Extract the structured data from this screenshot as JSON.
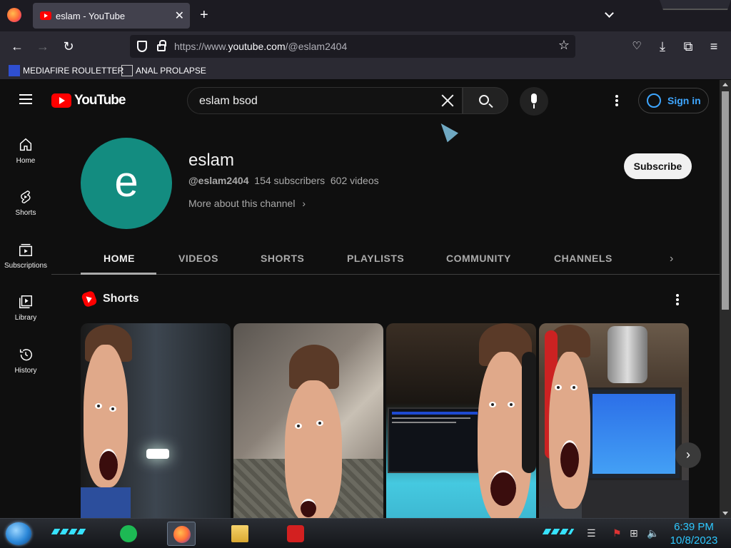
{
  "browser": {
    "tab_title": "eslam - YouTube",
    "new_tab_label": "+",
    "url_prefix": "https://www.",
    "url_domain": "youtube.com",
    "url_path": "/@eslam2404",
    "bookmarks": [
      "MEDIAFIRE ROULETTER",
      "ANAL PROLAPSE"
    ]
  },
  "youtube": {
    "logo_text": "YouTube",
    "search_value": "eslam bsod",
    "sign_in_label": "Sign in",
    "sidebar": [
      {
        "label": "Home",
        "icon": "home-icon"
      },
      {
        "label": "Shorts",
        "icon": "shorts-icon"
      },
      {
        "label": "Subscriptions",
        "icon": "subscriptions-icon"
      },
      {
        "label": "Library",
        "icon": "library-icon"
      },
      {
        "label": "History",
        "icon": "history-icon"
      }
    ],
    "channel": {
      "avatar_letter": "e",
      "avatar_color": "#138c80",
      "name": "eslam",
      "handle": "@eslam2404",
      "subscribers": "154 subscribers",
      "videos": "602 videos",
      "more_label": "More about this channel",
      "subscribe_label": "Subscribe"
    },
    "tabs": [
      "HOME",
      "VIDEOS",
      "SHORTS",
      "PLAYLISTS",
      "COMMUNITY",
      "CHANNELS"
    ],
    "active_tab": "HOME",
    "shorts_section_title": "Shorts"
  },
  "taskbar": {
    "time": "6:39 PM",
    "date": "10/8/2023"
  },
  "colors": {
    "accent": "#3ea6ff",
    "youtube_red": "#ff0000",
    "clock": "#2ec8ff"
  }
}
